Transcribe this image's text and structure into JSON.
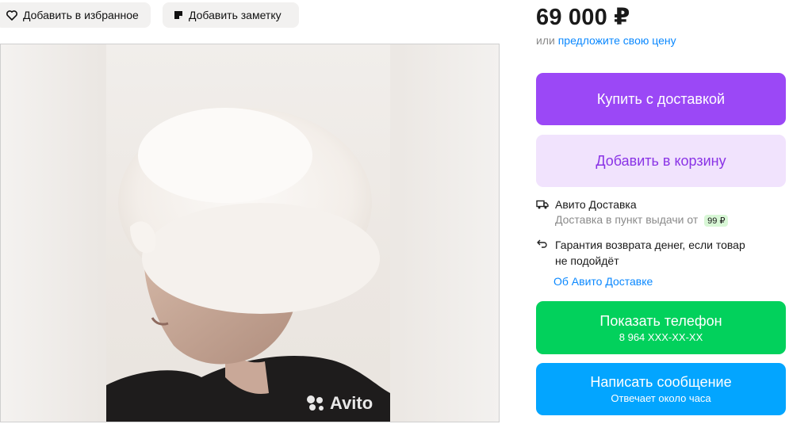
{
  "top_actions": {
    "favorite_label": "Добавить в избранное",
    "note_label": "Добавить заметку"
  },
  "photo": {
    "watermark": "Avito"
  },
  "price": {
    "amount": "69 000 ₽",
    "offer_prefix": "или",
    "offer_link": "предложите свою цену"
  },
  "buttons": {
    "buy": "Купить с доставкой",
    "cart": "Добавить в корзину",
    "phone": "Показать телефон",
    "phone_number": "8 964 XXX-XX-XX",
    "message": "Написать сообщение",
    "message_sub": "Отвечает около часа"
  },
  "delivery": {
    "title": "Авито Доставка",
    "pickup_text": "Доставка в пункт выдачи от",
    "pickup_price": "99 ₽",
    "guarantee_line1": "Гарантия возврата денег, если товар",
    "guarantee_line2": "не подойдёт",
    "about_link": "Об Авито Доставке"
  },
  "colors": {
    "buy": "#9b48f6",
    "cart_bg": "#f1e3fd",
    "phone": "#02d15c",
    "message": "#03a5ff",
    "link": "#0a88ff"
  }
}
